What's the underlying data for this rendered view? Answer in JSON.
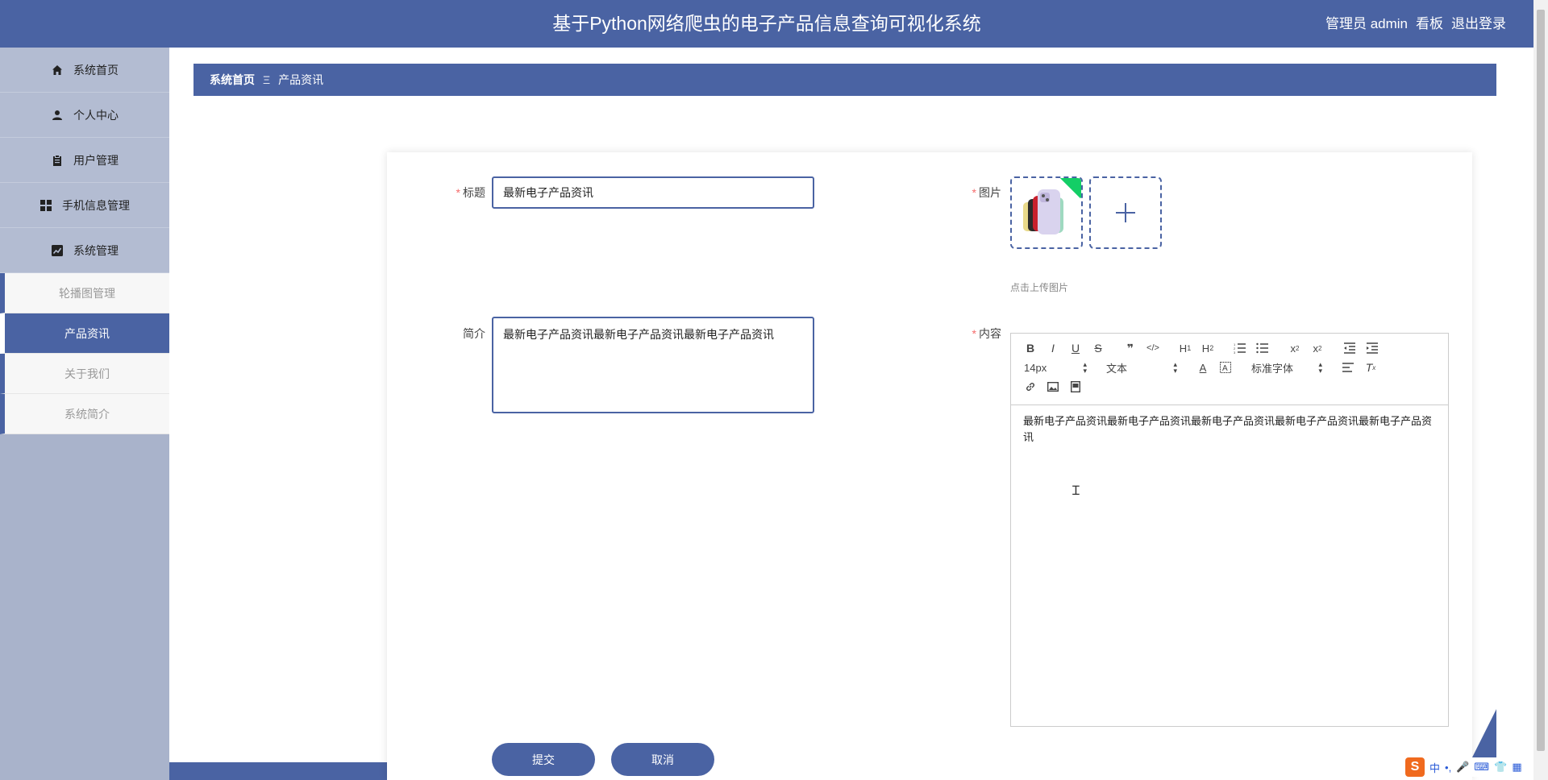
{
  "header": {
    "title": "基于Python网络爬虫的电子产品信息查询可视化系统",
    "user_label": "管理员 admin",
    "dashboard_link": "看板",
    "logout_link": "退出登录"
  },
  "sidebar": {
    "items": [
      {
        "label": "系统首页",
        "icon": "home-icon"
      },
      {
        "label": "个人中心",
        "icon": "user-icon"
      },
      {
        "label": "用户管理",
        "icon": "clipboard-icon"
      },
      {
        "label": "手机信息管理",
        "icon": "grid-icon"
      },
      {
        "label": "系统管理",
        "icon": "chart-icon"
      }
    ],
    "submenu": [
      {
        "label": "轮播图管理",
        "active": false
      },
      {
        "label": "产品资讯",
        "active": true
      },
      {
        "label": "关于我们",
        "active": false
      },
      {
        "label": "系统简介",
        "active": false
      }
    ]
  },
  "breadcrumb": {
    "home": "系统首页",
    "separator": "Ξ",
    "current": "产品资讯"
  },
  "form": {
    "title_label": "标题",
    "title_value": "最新电子产品资讯",
    "intro_label": "简介",
    "intro_value": "最新电子产品资讯最新电子产品资讯最新电子产品资讯",
    "image_label": "图片",
    "upload_tip": "点击上传图片",
    "content_label": "内容",
    "required_mark": "*"
  },
  "editor": {
    "font_size": "14px",
    "text_type": "文本",
    "font_family": "标准字体",
    "content": "最新电子产品资讯最新电子产品资讯最新电子产品资讯最新电子产品资讯最新电子产品资讯"
  },
  "buttons": {
    "submit": "提交",
    "cancel": "取消"
  },
  "ime": {
    "logo": "S",
    "mode": "中"
  },
  "colors": {
    "primary": "#4a63a3",
    "sidebar_bg": "#a9b3cb",
    "required": "#f56c6c"
  }
}
